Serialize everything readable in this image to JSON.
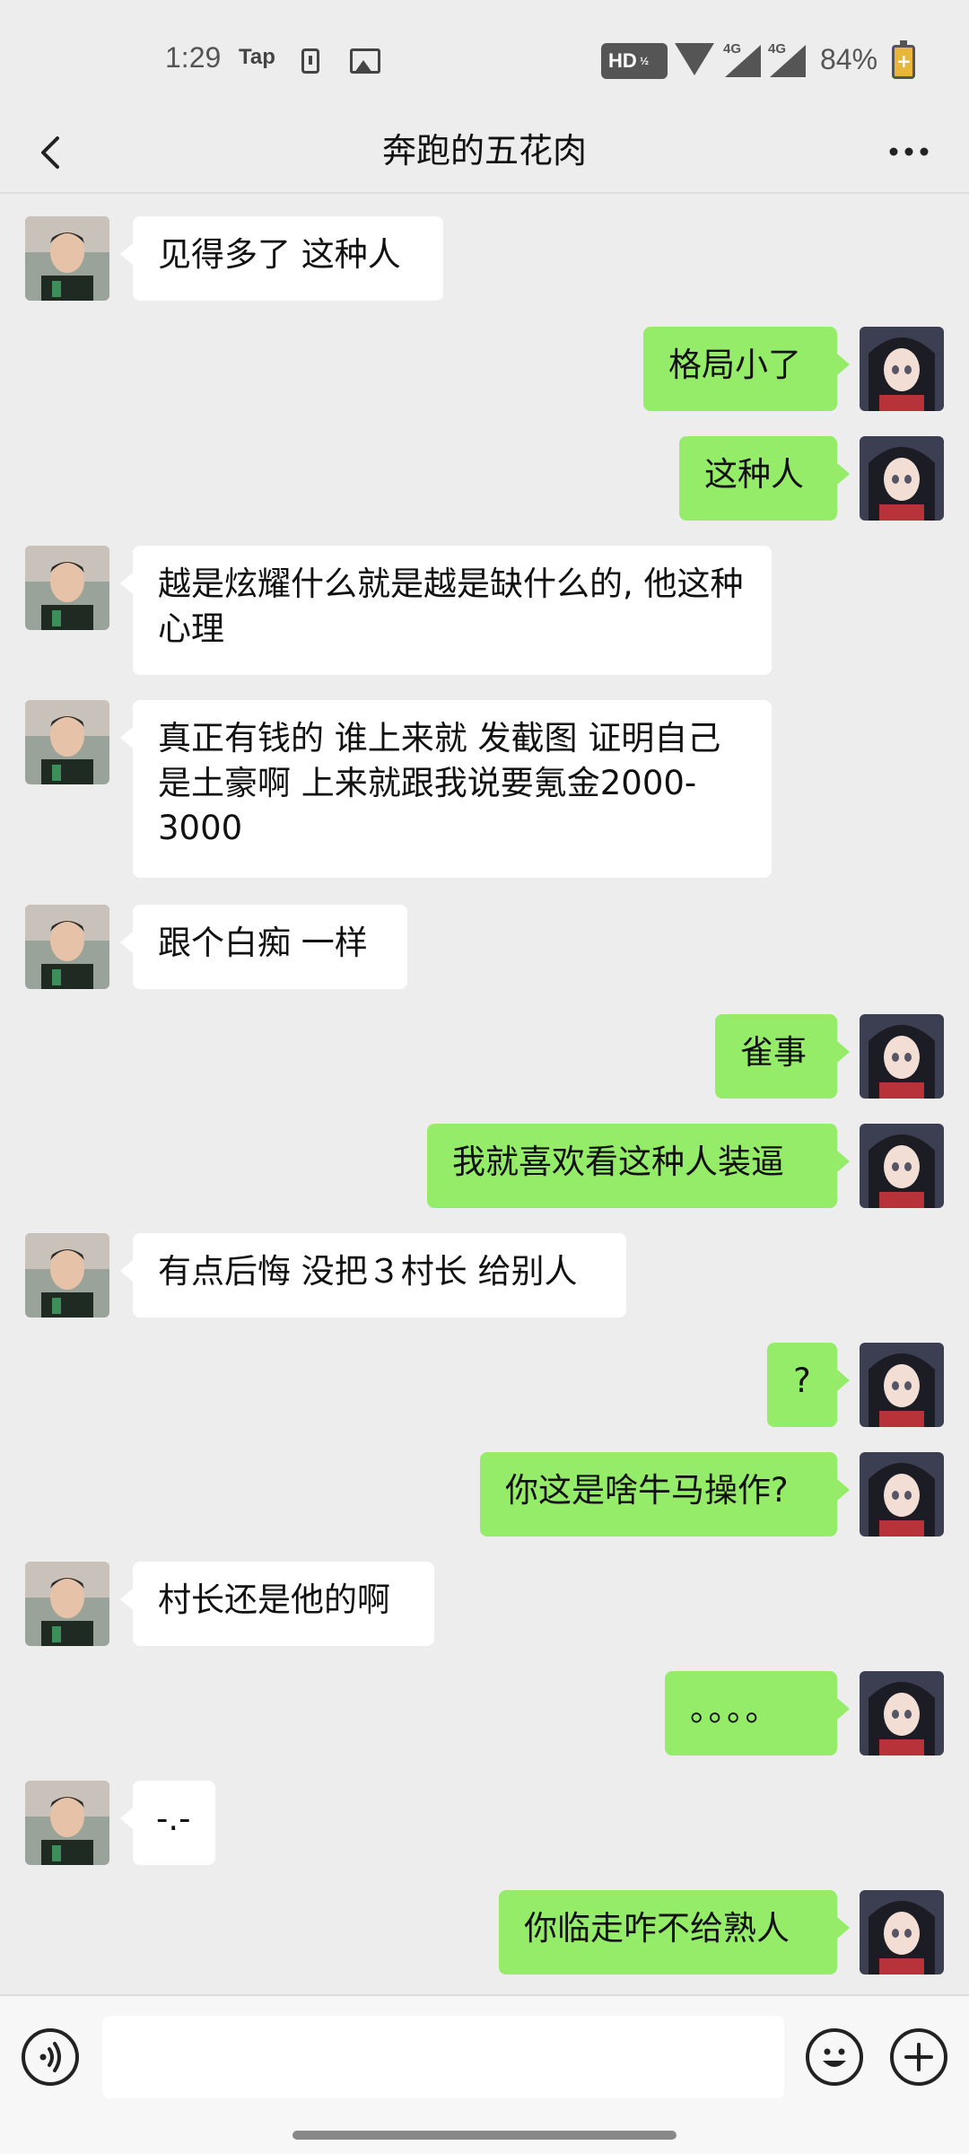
{
  "status_bar": {
    "time": "1:29",
    "app_label": "Tap",
    "hd_label": "HD",
    "network_1": "4G",
    "network_2": "4G",
    "battery_percent": "84%",
    "icons": [
      "download-icon",
      "image-icon",
      "wifi-icon",
      "signal-icon",
      "battery-charging-icon"
    ]
  },
  "nav": {
    "title": "奔跑的五花肉",
    "back_icon": "chevron-left-icon",
    "more_icon": "more-dots-icon"
  },
  "messages": [
    {
      "side": "in",
      "text": "见得多了 这种人"
    },
    {
      "side": "out",
      "text": "格局小了"
    },
    {
      "side": "out",
      "text": "这种人"
    },
    {
      "side": "in",
      "text": "越是炫耀什么就是越是缺什么的, 他这种心理"
    },
    {
      "side": "in",
      "text": "真正有钱的 谁上来就 发截图 证明自己是土豪啊  上来就跟我说要氪金2000-3000"
    },
    {
      "side": "in",
      "text": "跟个白痴 一样"
    },
    {
      "side": "out",
      "text": "雀事"
    },
    {
      "side": "out",
      "text": "我就喜欢看这种人装逼"
    },
    {
      "side": "in",
      "text": "有点后悔 没把３村长 给别人"
    },
    {
      "side": "out",
      "text": "?"
    },
    {
      "side": "out",
      "text": "你这是啥牛马操作?"
    },
    {
      "side": "in",
      "text": "村长还是他的啊"
    },
    {
      "side": "out",
      "text": "。。。。"
    },
    {
      "side": "in",
      "text": "-.-"
    },
    {
      "side": "out",
      "text": "你临走咋不给熟人"
    }
  ],
  "input_bar": {
    "voice_icon": "voice-icon",
    "emoji_icon": "emoji-icon",
    "plus_icon": "plus-icon",
    "text_value": ""
  },
  "colors": {
    "background": "#ededed",
    "outgoing_bubble": "#95ec69",
    "incoming_bubble": "#ffffff"
  }
}
